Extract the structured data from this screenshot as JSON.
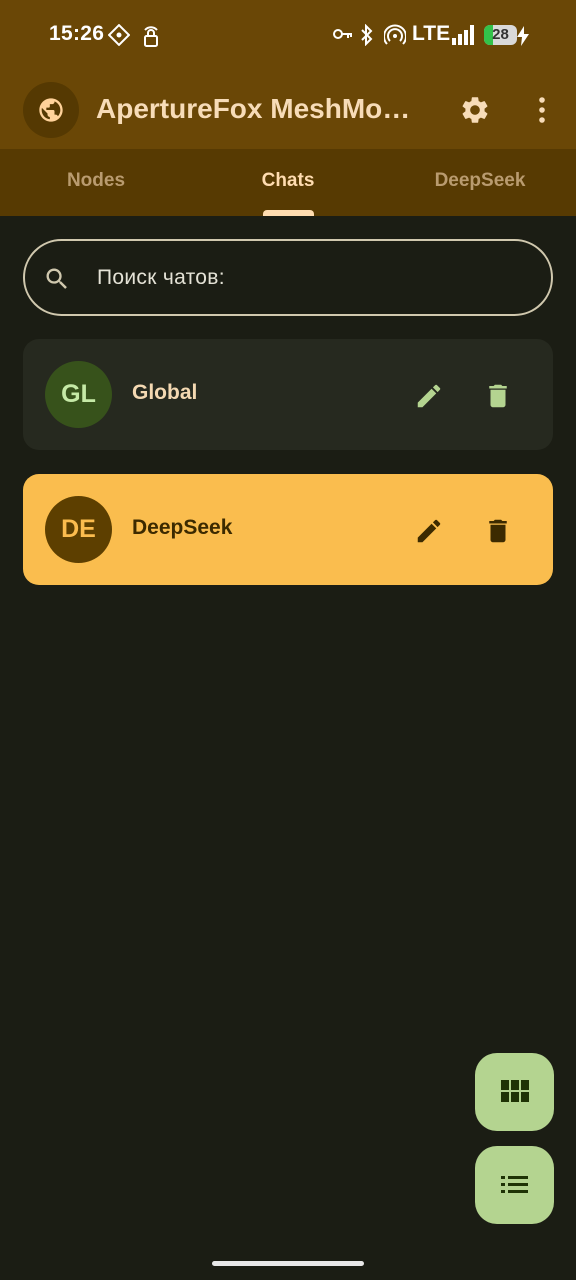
{
  "status_bar": {
    "time": "15:26",
    "network": "LTE",
    "battery": "28",
    "icons": [
      "sim-diamond-icon",
      "lock-signal-icon",
      "key-icon",
      "bluetooth-icon",
      "hotspot-icon",
      "signal-bars-icon",
      "battery-icon",
      "charging-bolt-icon"
    ]
  },
  "app_bar": {
    "title": "ApertureFox MeshMobile",
    "logo_icon": "globe-icon",
    "actions": [
      "gear-icon",
      "more-vert-icon"
    ]
  },
  "tabs": [
    {
      "label": "Nodes",
      "active": false
    },
    {
      "label": "Chats",
      "active": true
    },
    {
      "label": "DeepSeek",
      "active": false
    }
  ],
  "search": {
    "placeholder": "Поиск чатов:",
    "value": ""
  },
  "chats": [
    {
      "initials": "GL",
      "name": "Global",
      "selected": false
    },
    {
      "initials": "DE",
      "name": "DeepSeek",
      "selected": true
    }
  ],
  "fabs": [
    "grid-view-icon",
    "list-view-icon"
  ],
  "colors": {
    "background": "#1b1d14",
    "app_bar": "#6a4706",
    "tab_bar": "#573a02",
    "accent": "#fabd4e",
    "card": "#26291f",
    "fab": "#b4d490",
    "title_text": "#f7dcb8"
  }
}
